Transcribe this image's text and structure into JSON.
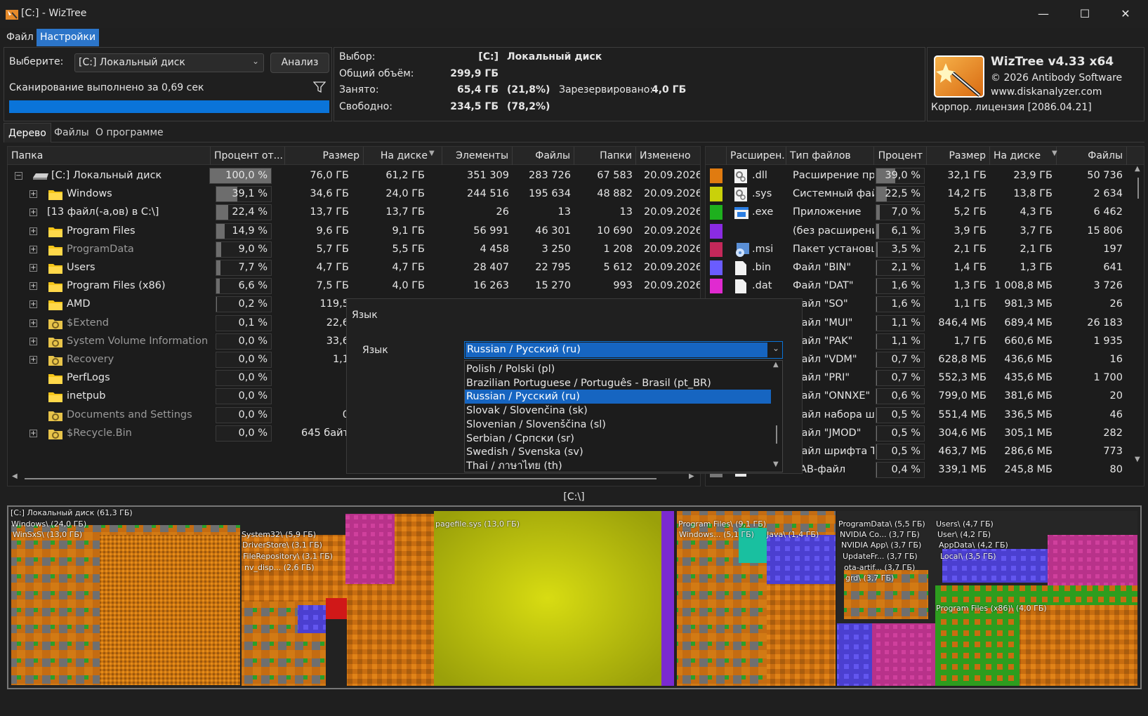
{
  "window": {
    "title": "[C:]  - WizTree",
    "minimize": "—",
    "maximize": "☐",
    "close": "✕"
  },
  "menu": {
    "file": "Файл",
    "settings": "Настройки"
  },
  "scan": {
    "select_label": "Выберите:",
    "drive_value": "[C:] Локальный диск",
    "analyze_button": "Анализ",
    "status": "Сканирование выполнено за 0,69 сек",
    "progress_percent": 100
  },
  "info": {
    "selection_label": "Выбор:",
    "selection_drive": "[C:]",
    "selection_name": "Локальный диск",
    "total_label": "Общий объём:",
    "total_value": "299,9 ГБ",
    "used_label": "Занято:",
    "used_value": "65,4 ГБ",
    "used_pct": "(21,8%)",
    "reserved_label": "Зарезервировано:",
    "reserved_value": "4,0 ГБ",
    "free_label": "Свободно:",
    "free_value": "234,5 ГБ",
    "free_pct": "(78,2%)"
  },
  "about": {
    "product": "WizTree v4.33 x64",
    "copyright": "© 2026 Antibody Software",
    "website": "www.diskanalyzer.com",
    "license": "Корпор. лицензия [2086.04.21]"
  },
  "tabs": {
    "tree": "Дерево",
    "files": "Файлы",
    "about": "О программе"
  },
  "tree": {
    "headers": {
      "folder": "Папка",
      "percent": "Процент от...",
      "size": "Размер",
      "on_disk": "На диске",
      "items": "Элементы",
      "files": "Файлы",
      "folders": "Папки",
      "modified": "Изменено"
    },
    "rows": [
      {
        "name": "[C:] Локальный диск",
        "pct": "100,0 %",
        "pct_value": 100,
        "size": "76,0 ГБ",
        "disk": "61,2 ГБ",
        "items": "351 309",
        "files": "283 726",
        "folders": "67 583",
        "modified": "20.09.2026 "
      },
      {
        "name": "Windows",
        "pct": "39,1 %",
        "pct_value": 39.1,
        "size": "34,6 ГБ",
        "disk": "24,0 ГБ",
        "items": "244 516",
        "files": "195 634",
        "folders": "48 882",
        "modified": "20.09.2026 "
      },
      {
        "name": "[13 файл(-а,ов) в C:\\]",
        "pct": "22,4 %",
        "pct_value": 22.4,
        "size": "13,7 ГБ",
        "disk": "13,7 ГБ",
        "items": "26",
        "files": "13",
        "folders": "13",
        "modified": "20.09.2026 "
      },
      {
        "name": "Program Files",
        "pct": "14,9 %",
        "pct_value": 14.9,
        "size": "9,6 ГБ",
        "disk": "9,1 ГБ",
        "items": "56 991",
        "files": "46 301",
        "folders": "10 690",
        "modified": "20.09.2026 "
      },
      {
        "name": "ProgramData",
        "pct": "9,0 %",
        "pct_value": 9.0,
        "size": "5,7 ГБ",
        "disk": "5,5 ГБ",
        "items": "4 458",
        "files": "3 250",
        "folders": "1 208",
        "modified": "20.09.2026 "
      },
      {
        "name": "Users",
        "pct": "7,7 %",
        "pct_value": 7.7,
        "size": "4,7 ГБ",
        "disk": "4,7 ГБ",
        "items": "28 407",
        "files": "22 795",
        "folders": "5 612",
        "modified": "20.09.2026 "
      },
      {
        "name": "Program Files (x86)",
        "pct": "6,6 %",
        "pct_value": 6.6,
        "size": "7,5 ГБ",
        "disk": "4,0 ГБ",
        "items": "16 263",
        "files": "15 270",
        "folders": "993",
        "modified": "20.09.2026 "
      },
      {
        "name": "AMD",
        "pct": "0,2 %",
        "pct_value": 0.2,
        "size": "119,5",
        "disk": "",
        "items": "",
        "files": "",
        "folders": "",
        "modified": ""
      },
      {
        "name": "$Extend",
        "pct": "0,1 %",
        "pct_value": 0.1,
        "size": "22,6",
        "disk": "",
        "items": "",
        "files": "",
        "folders": "",
        "modified": ""
      },
      {
        "name": "System Volume Information",
        "pct": "0,0 %",
        "pct_value": 0,
        "size": "33,6",
        "disk": "",
        "items": "",
        "files": "",
        "folders": "",
        "modified": ""
      },
      {
        "name": "Recovery",
        "pct": "0,0 %",
        "pct_value": 0,
        "size": "1,1",
        "disk": "",
        "items": "",
        "files": "",
        "folders": "",
        "modified": ""
      },
      {
        "name": "PerfLogs",
        "pct": "0,0 %",
        "pct_value": 0,
        "size": "",
        "disk": "",
        "items": "",
        "files": "",
        "folders": "",
        "modified": ""
      },
      {
        "name": "inetpub",
        "pct": "0,0 %",
        "pct_value": 0,
        "size": "",
        "disk": "",
        "items": "",
        "files": "",
        "folders": "",
        "modified": ""
      },
      {
        "name": "Documents and Settings",
        "pct": "0,0 %",
        "pct_value": 0,
        "size": "0",
        "disk": "0",
        "items": "",
        "files": "",
        "folders": "",
        "modified": ""
      },
      {
        "name": "$Recycle.Bin",
        "pct": "0,0 %",
        "pct_value": 0,
        "size": "645 байт",
        "disk": "0",
        "items": "",
        "files": "",
        "folders": "",
        "modified": ""
      }
    ]
  },
  "ext": {
    "headers": {
      "ext": "Расширен...",
      "type": "Тип файлов",
      "percent": "Процент",
      "size": "Размер",
      "on_disk": "На диске",
      "files": "Файлы"
    },
    "rows": [
      {
        "color": "#e07b10",
        "ext": ".dll",
        "type": "Расширение при",
        "pct": "39,0 %",
        "pct_value": 39.0,
        "size": "32,1 ГБ",
        "disk": "23,9 ГБ",
        "files": "50 736"
      },
      {
        "color": "#c9d10a",
        "ext": ".sys",
        "type": "Системный фай.",
        "pct": "22,5 %",
        "pct_value": 22.5,
        "size": "14,2 ГБ",
        "disk": "13,8 ГБ",
        "files": "2 634"
      },
      {
        "color": "#1eb01e",
        "ext": ".exe",
        "type": "Приложение",
        "pct": "7,0 %",
        "pct_value": 7.0,
        "size": "5,2 ГБ",
        "disk": "4,3 ГБ",
        "files": "6 462"
      },
      {
        "color": "#8a2be2",
        "ext": "",
        "type": "(без расширени",
        "pct": "6,1 %",
        "pct_value": 6.1,
        "size": "3,9 ГБ",
        "disk": "3,7 ГБ",
        "files": "15 806"
      },
      {
        "color": "#c4285a",
        "ext": ".msi",
        "type": "Пакет установщ",
        "pct": "3,5 %",
        "pct_value": 3.5,
        "size": "2,1 ГБ",
        "disk": "2,1 ГБ",
        "files": "197"
      },
      {
        "color": "#6a5cff",
        "ext": ".bin",
        "type": "Файл \"BIN\"",
        "pct": "2,1 %",
        "pct_value": 2.1,
        "size": "1,4 ГБ",
        "disk": "1,3 ГБ",
        "files": "641"
      },
      {
        "color": "#e02ad0",
        "ext": ".dat",
        "type": "Файл \"DAT\"",
        "pct": "1,6 %",
        "pct_value": 1.6,
        "size": "1,3 ГБ",
        "disk": "1 008,8 МБ",
        "files": "3 726"
      },
      {
        "color": "",
        "ext": "",
        "type": "Файл \"SO\"",
        "pct": "1,6 %",
        "pct_value": 1.6,
        "size": "1,1 ГБ",
        "disk": "981,3 МБ",
        "files": "26"
      },
      {
        "color": "",
        "ext": "",
        "type": "Файл \"MUI\"",
        "pct": "1,1 %",
        "pct_value": 1.1,
        "size": "846,4 МБ",
        "disk": "689,4 МБ",
        "files": "26 183"
      },
      {
        "color": "",
        "ext": "",
        "type": "Файл \"PAK\"",
        "pct": "1,1 %",
        "pct_value": 1.1,
        "size": "1,7 ГБ",
        "disk": "660,6 МБ",
        "files": "1 935"
      },
      {
        "color": "",
        "ext": "",
        "type": "Файл \"VDM\"",
        "pct": "0,7 %",
        "pct_value": 0.7,
        "size": "628,8 МБ",
        "disk": "436,6 МБ",
        "files": "16"
      },
      {
        "color": "",
        "ext": "",
        "type": "Файл \"PRI\"",
        "pct": "0,7 %",
        "pct_value": 0.7,
        "size": "552,3 МБ",
        "disk": "435,6 МБ",
        "files": "1 700"
      },
      {
        "color": "",
        "ext": "",
        "type": "Файл \"ONNXE\"",
        "pct": "0,6 %",
        "pct_value": 0.6,
        "size": "799,0 МБ",
        "disk": "381,6 МБ",
        "files": "20"
      },
      {
        "color": "",
        "ext": "",
        "type": "Файл набора ш",
        "pct": "0,5 %",
        "pct_value": 0.5,
        "size": "551,4 МБ",
        "disk": "336,5 МБ",
        "files": "46"
      },
      {
        "color": "",
        "ext": "",
        "type": "Файл \"JMOD\"",
        "pct": "0,5 %",
        "pct_value": 0.5,
        "size": "304,6 МБ",
        "disk": "305,1 МБ",
        "files": "282"
      },
      {
        "color": "",
        "ext": "",
        "type": "Файл шрифта Tr",
        "pct": "0,5 %",
        "pct_value": 0.5,
        "size": "463,7 МБ",
        "disk": "286,6 МБ",
        "files": "773"
      },
      {
        "color": "#777777",
        "ext": ".cab",
        "type": "CAB-файл",
        "pct": "0,4 %",
        "pct_value": 0.4,
        "size": "339,1 МБ",
        "disk": "245,8 МБ",
        "files": "80"
      }
    ]
  },
  "language_dialog": {
    "title": "Язык",
    "label": "Язык",
    "selected": "Russian / Русский (ru)",
    "options": [
      "Polish / Polski  (pl)",
      "Brazilian Portuguese / Português - Brasil (pt_BR)",
      "Russian / Русский (ru)",
      "Slovak / Slovenčina (sk)",
      "Slovenian / Slovenščina (sl)",
      "Serbian / Српски (sr)",
      "Swedish / Svenska (sv)",
      "Thai / ภาษาไทย (th)"
    ],
    "selected_index": 2
  },
  "treemap": {
    "path": "[C:\\]",
    "labels": {
      "root": "[C:] Локальный диск (61,3 ГБ)",
      "windows": "Windows\\ (24,0 ГБ)",
      "winsxs": "WinSxS\\ (13,0 ГБ)",
      "system32": "System32\\ (5,9 ГБ)",
      "driverstore": "DriverStore\\ (3,1 ГБ)",
      "filerepository": "FileRepository\\ (3,1 ГБ)",
      "nvdisp": "nv_disp... (2,6 ГБ)",
      "pagefile": "pagefile.sys (13,0 ГБ)",
      "programfiles": "Program Files\\ (9,1 ГБ)",
      "windows_pf": "Windows... (5,1 ГБ)",
      "java": "Java\\ (1,4 ГБ)",
      "programdata": "ProgramData\\ (5,5 ГБ)",
      "nvidia_co": "NVIDIA Co... (3,7 ГБ)",
      "nvidia_app": "NVIDIA App\\ (3,7 ГБ)",
      "updatefr": "UpdateFr... (3,7 ГБ)",
      "otaartif": "ota-artif... (3,7 ГБ)",
      "grd": "grd\\ (3,7 ГБ)",
      "users": "Users\\ (4,7 ГБ)",
      "user": "User\\ (4,2 ГБ)",
      "appdata": "AppData\\ (4,2 ГБ)",
      "local": "Local\\ (3,5 ГБ)",
      "pfx86": "Program Files (x86)\\ (4,0 ГБ)"
    }
  }
}
